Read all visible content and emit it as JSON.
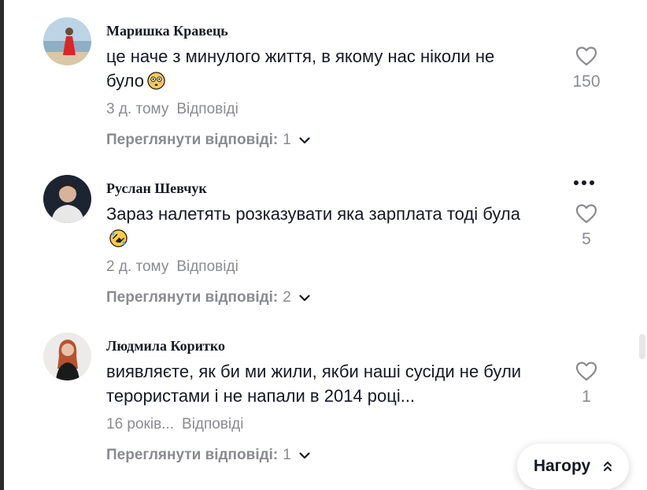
{
  "comments": [
    {
      "username": "Маришка Кравець",
      "text": "це наче з минулого життя, в якому нас ніколи не було",
      "emoji": "flushed-face",
      "time": "3 д. тому",
      "reply_label": "Відповіді",
      "view_replies_label": "Переглянути відповіді:",
      "replies_count": "1",
      "likes": "150"
    },
    {
      "username": "Руслан Шевчук",
      "text": "Зараз налетять розказувати яка зарплата тоді була",
      "emoji": "rolling-on-floor-laughing",
      "time": "2 д. тому",
      "reply_label": "Відповіді",
      "view_replies_label": "Переглянути відповіді:",
      "replies_count": "2",
      "likes": "5"
    },
    {
      "username": "Людмила Коритко",
      "text": "виявляєте, як би ми жили, якби наші сусіди не були терористами і не напали в 2014 році...",
      "emoji": "",
      "time": "16 років...",
      "reply_label": "Відповіді",
      "view_replies_label": "Переглянути відповіді:",
      "replies_count": "1",
      "likes": "1"
    }
  ],
  "back_to_top": {
    "label": "Нагору"
  }
}
